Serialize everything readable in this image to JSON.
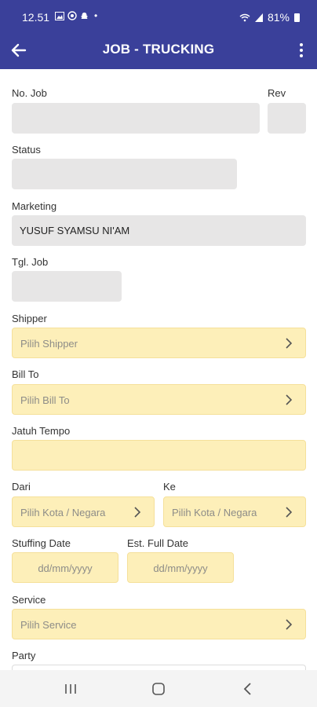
{
  "status_bar": {
    "time": "12.51",
    "battery": "81%",
    "dot": "•"
  },
  "app_bar": {
    "title": "JOB - TRUCKING"
  },
  "form": {
    "no_job_label": "No. Job",
    "rev_label": "Rev",
    "status_label": "Status",
    "marketing_label": "Marketing",
    "marketing_value": "YUSUF SYAMSU NI'AM",
    "tgl_job_label": "Tgl. Job",
    "shipper_label": "Shipper",
    "shipper_placeholder": "Pilih Shipper",
    "bill_to_label": "Bill To",
    "bill_to_placeholder": "Pilih Bill To",
    "jatuh_tempo_label": "Jatuh Tempo",
    "dari_label": "Dari",
    "dari_placeholder": "Pilih Kota / Negara",
    "ke_label": "Ke",
    "ke_placeholder": "Pilih Kota / Negara",
    "stuffing_date_label": "Stuffing Date",
    "stuffing_date_placeholder": "dd/mm/yyyy",
    "est_full_date_label": "Est. Full Date",
    "est_full_date_placeholder": "dd/mm/yyyy",
    "service_label": "Service",
    "service_placeholder": "Pilih Service",
    "party_label": "Party"
  },
  "colors": {
    "primary": "#3a409a",
    "field_grey": "#e7e6e6",
    "field_yellow": "#fdefb9"
  }
}
